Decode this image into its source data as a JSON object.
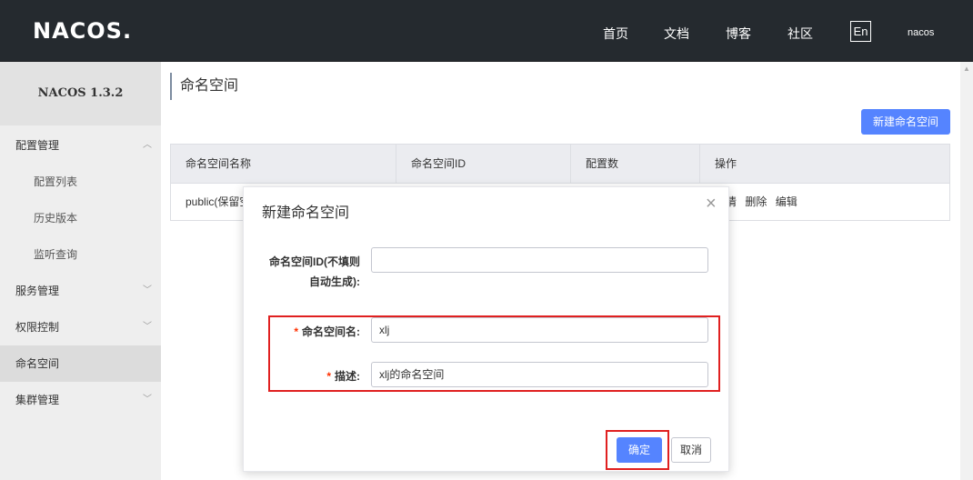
{
  "header": {
    "logo": "NACOS.",
    "nav": [
      "首页",
      "文档",
      "博客",
      "社区"
    ],
    "lang": "En",
    "user": "nacos"
  },
  "sidebar": {
    "version": "NACOS 1.3.2",
    "items": [
      {
        "label": "配置管理",
        "chevron": "︿"
      },
      {
        "label": "配置列表"
      },
      {
        "label": "历史版本"
      },
      {
        "label": "监听查询"
      },
      {
        "label": "服务管理",
        "chevron": "﹀"
      },
      {
        "label": "权限控制",
        "chevron": "﹀"
      },
      {
        "label": "命名空间"
      },
      {
        "label": "集群管理",
        "chevron": "﹀"
      }
    ]
  },
  "main": {
    "title": "命名空间",
    "create_button": "新建命名空间",
    "table": {
      "headers": [
        "命名空间名称",
        "命名空间ID",
        "配置数",
        "操作"
      ],
      "rows": [
        {
          "name": "public(保留空间)",
          "ops": [
            "详情",
            "删除",
            "编辑"
          ]
        }
      ]
    }
  },
  "dialog": {
    "title": "新建命名空间",
    "close": "×",
    "id_label_line1": "命名空间ID(不填则",
    "id_label_line2": "自动生成):",
    "id_value": "",
    "name_label": "命名空间名:",
    "name_value": "xlj",
    "desc_label": "描述:",
    "desc_value": "xlj的命名空间",
    "required_mark": "*",
    "ok": "确定",
    "cancel": "取消"
  },
  "colors": {
    "header_bg": "#252a2f",
    "primary": "#5584ff",
    "highlight": "#e02020"
  }
}
